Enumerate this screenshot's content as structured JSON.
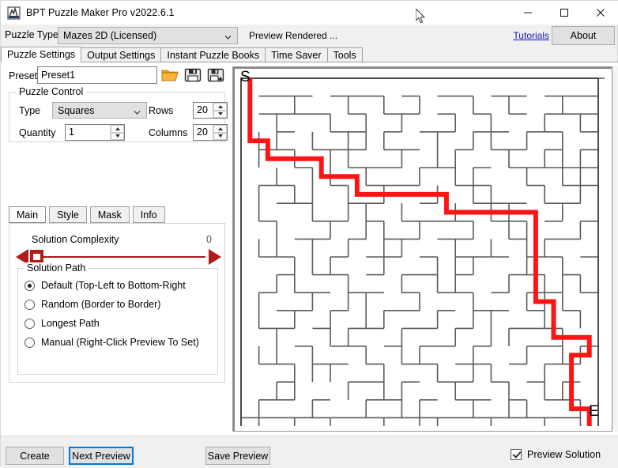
{
  "window": {
    "title": "BPT Puzzle Maker Pro v2022.6.1",
    "icon": "app-icon",
    "minimize_label": "—",
    "maximize_label": "□",
    "close_label": "✕"
  },
  "toolbar": {
    "puzzle_type_label": "Puzzle Type",
    "puzzle_type_value": "Mazes 2D (Licensed)",
    "puzzle_type_options": [
      "Mazes 2D (Licensed)"
    ],
    "preview_status": "Preview Rendered ...",
    "tutorials_label": "Tutorials",
    "about_label": "About"
  },
  "tabs": [
    {
      "label": "Puzzle Settings",
      "active": true
    },
    {
      "label": "Output Settings",
      "active": false
    },
    {
      "label": "Instant Puzzle Books",
      "active": false
    },
    {
      "label": "Time Saver",
      "active": false
    },
    {
      "label": "Tools",
      "active": false
    }
  ],
  "preset": {
    "label": "Preset",
    "value": "Preset1",
    "placeholder": "",
    "open_icon": "folder-open-icon",
    "save_icon": "floppy-save-icon",
    "save_as_icon": "floppy-save-as-icon"
  },
  "puzzle_control": {
    "title": "Puzzle Control",
    "type_label": "Type",
    "type_value": "Squares",
    "type_options": [
      "Squares"
    ],
    "quantity_label": "Quantity",
    "quantity_value": "1",
    "rows_label": "Rows",
    "rows_value": "20",
    "columns_label": "Columns",
    "columns_value": "20"
  },
  "inner_tabs": [
    {
      "label": "Main",
      "active": true
    },
    {
      "label": "Style",
      "active": false
    },
    {
      "label": "Mask",
      "active": false
    },
    {
      "label": "Info",
      "active": false
    }
  ],
  "complexity": {
    "label": "Solution Complexity",
    "value": "0",
    "min": 0,
    "max": 100,
    "position_pct": 0
  },
  "solution_path": {
    "title": "Solution Path",
    "options": [
      {
        "label": "Default (Top-Left to Bottom-Right",
        "checked": true
      },
      {
        "label": "Random (Border to Border)",
        "checked": false
      },
      {
        "label": "Longest Path",
        "checked": false
      },
      {
        "label": "Manual (Right-Click Preview To Set)",
        "checked": false
      }
    ]
  },
  "preview": {
    "start_letter": "S",
    "end_letter": "E",
    "solution_color": "#ff1414",
    "wall_color": "#5a5a5a",
    "border_color": "#4a4a4a",
    "background": "#ffffff",
    "rows": 20,
    "columns": 20
  },
  "bottom": {
    "create_label": "Create",
    "next_preview_label": "Next Preview",
    "save_preview_label": "Save Preview",
    "preview_solution_label": "Preview Solution",
    "preview_solution_checked": true
  },
  "maze": {
    "cell": 22.6,
    "ox": 6,
    "oy": 10,
    "h_walls": [
      [
        0,
        0,
        20
      ],
      [
        20,
        0,
        1
      ],
      [
        1,
        1,
        3
      ],
      [
        5,
        1,
        1
      ],
      [
        6,
        1,
        2
      ],
      [
        9,
        1,
        1
      ],
      [
        11,
        1,
        2
      ],
      [
        14,
        1,
        2
      ],
      [
        17,
        1,
        3
      ],
      [
        1,
        2,
        3
      ],
      [
        4,
        2,
        1
      ],
      [
        6,
        2,
        1
      ],
      [
        8,
        2,
        2
      ],
      [
        11,
        2,
        1
      ],
      [
        13,
        2,
        1
      ],
      [
        15,
        2,
        1
      ],
      [
        17,
        2,
        3
      ],
      [
        2,
        3,
        1
      ],
      [
        5,
        3,
        2
      ],
      [
        8,
        3,
        1
      ],
      [
        10,
        3,
        2
      ],
      [
        13,
        3,
        2
      ],
      [
        16,
        3,
        2
      ],
      [
        19,
        3,
        1
      ],
      [
        1,
        4,
        2
      ],
      [
        4,
        4,
        3
      ],
      [
        8,
        4,
        2
      ],
      [
        12,
        4,
        1
      ],
      [
        14,
        4,
        2
      ],
      [
        17,
        4,
        1
      ],
      [
        19,
        4,
        1
      ],
      [
        3,
        5,
        1
      ],
      [
        6,
        5,
        3
      ],
      [
        10,
        5,
        2
      ],
      [
        13,
        5,
        1
      ],
      [
        15,
        5,
        3
      ],
      [
        18,
        5,
        2
      ],
      [
        1,
        6,
        2
      ],
      [
        5,
        6,
        1
      ],
      [
        7,
        6,
        2
      ],
      [
        9,
        6,
        1
      ],
      [
        12,
        6,
        2
      ],
      [
        16,
        6,
        1
      ],
      [
        18,
        6,
        2
      ],
      [
        2,
        7,
        2
      ],
      [
        6,
        7,
        2
      ],
      [
        10,
        7,
        1
      ],
      [
        13,
        7,
        2
      ],
      [
        15,
        7,
        1
      ],
      [
        17,
        7,
        2
      ],
      [
        1,
        8,
        1
      ],
      [
        4,
        8,
        2
      ],
      [
        7,
        8,
        1
      ],
      [
        9,
        8,
        3
      ],
      [
        12,
        8,
        1
      ],
      [
        14,
        8,
        2
      ],
      [
        17,
        8,
        1
      ],
      [
        19,
        8,
        1
      ],
      [
        3,
        9,
        2
      ],
      [
        6,
        9,
        1
      ],
      [
        8,
        9,
        2
      ],
      [
        11,
        9,
        2
      ],
      [
        15,
        9,
        1
      ],
      [
        17,
        9,
        2
      ],
      [
        1,
        10,
        2
      ],
      [
        5,
        10,
        1
      ],
      [
        7,
        10,
        2
      ],
      [
        10,
        10,
        1
      ],
      [
        12,
        10,
        2
      ],
      [
        14,
        10,
        1
      ],
      [
        16,
        10,
        2
      ],
      [
        19,
        10,
        1
      ],
      [
        2,
        11,
        1
      ],
      [
        4,
        11,
        2
      ],
      [
        7,
        11,
        1
      ],
      [
        9,
        11,
        2
      ],
      [
        12,
        11,
        1
      ],
      [
        15,
        11,
        2
      ],
      [
        18,
        11,
        1
      ],
      [
        1,
        12,
        1
      ],
      [
        3,
        12,
        2
      ],
      [
        6,
        12,
        2
      ],
      [
        9,
        12,
        1
      ],
      [
        11,
        12,
        2
      ],
      [
        14,
        12,
        1
      ],
      [
        16,
        12,
        2
      ],
      [
        19,
        12,
        1
      ],
      [
        2,
        13,
        2
      ],
      [
        5,
        13,
        1
      ],
      [
        8,
        13,
        2
      ],
      [
        11,
        13,
        1
      ],
      [
        13,
        13,
        2
      ],
      [
        16,
        13,
        1
      ],
      [
        18,
        13,
        1
      ],
      [
        1,
        14,
        2
      ],
      [
        4,
        14,
        1
      ],
      [
        6,
        14,
        2
      ],
      [
        9,
        14,
        2
      ],
      [
        12,
        14,
        1
      ],
      [
        15,
        14,
        2
      ],
      [
        17,
        14,
        1
      ],
      [
        3,
        15,
        1
      ],
      [
        5,
        15,
        2
      ],
      [
        8,
        15,
        1
      ],
      [
        10,
        15,
        2
      ],
      [
        13,
        15,
        1
      ],
      [
        16,
        15,
        2
      ],
      [
        19,
        15,
        1
      ],
      [
        1,
        16,
        2
      ],
      [
        4,
        16,
        2
      ],
      [
        7,
        16,
        1
      ],
      [
        9,
        16,
        2
      ],
      [
        12,
        16,
        2
      ],
      [
        15,
        16,
        1
      ],
      [
        17,
        16,
        2
      ],
      [
        2,
        17,
        1
      ],
      [
        6,
        17,
        2
      ],
      [
        9,
        17,
        1
      ],
      [
        11,
        17,
        2
      ],
      [
        14,
        17,
        1
      ],
      [
        16,
        17,
        1
      ],
      [
        18,
        17,
        1
      ],
      [
        1,
        18,
        2
      ],
      [
        4,
        18,
        1
      ],
      [
        7,
        18,
        2
      ],
      [
        10,
        18,
        1
      ],
      [
        12,
        18,
        2
      ],
      [
        15,
        18,
        1
      ],
      [
        17,
        18,
        2
      ],
      [
        0,
        19,
        19
      ],
      [
        0,
        20,
        20
      ]
    ],
    "v_walls": [
      [
        0,
        0,
        20
      ],
      [
        20,
        0,
        20
      ],
      [
        3,
        1,
        1
      ],
      [
        6,
        1,
        1
      ],
      [
        8,
        1,
        1
      ],
      [
        10,
        1,
        1
      ],
      [
        13,
        1,
        1
      ],
      [
        15,
        1,
        1
      ],
      [
        18,
        1,
        1
      ],
      [
        2,
        2,
        2
      ],
      [
        5,
        2,
        1
      ],
      [
        7,
        2,
        2
      ],
      [
        9,
        2,
        1
      ],
      [
        12,
        2,
        1
      ],
      [
        14,
        2,
        2
      ],
      [
        17,
        2,
        1
      ],
      [
        19,
        2,
        1
      ],
      [
        1,
        3,
        2
      ],
      [
        4,
        3,
        1
      ],
      [
        6,
        3,
        2
      ],
      [
        8,
        3,
        1
      ],
      [
        11,
        3,
        2
      ],
      [
        13,
        3,
        1
      ],
      [
        16,
        3,
        1
      ],
      [
        18,
        3,
        2
      ],
      [
        3,
        4,
        1
      ],
      [
        5,
        4,
        2
      ],
      [
        9,
        4,
        1
      ],
      [
        12,
        4,
        2
      ],
      [
        15,
        4,
        1
      ],
      [
        17,
        4,
        1
      ],
      [
        19,
        4,
        2
      ],
      [
        2,
        5,
        1
      ],
      [
        4,
        5,
        2
      ],
      [
        7,
        5,
        1
      ],
      [
        10,
        5,
        1
      ],
      [
        13,
        5,
        2
      ],
      [
        16,
        5,
        1
      ],
      [
        18,
        5,
        1
      ],
      [
        1,
        6,
        2
      ],
      [
        3,
        6,
        1
      ],
      [
        6,
        6,
        2
      ],
      [
        8,
        6,
        1
      ],
      [
        11,
        6,
        1
      ],
      [
        14,
        6,
        2
      ],
      [
        17,
        6,
        1
      ],
      [
        19,
        6,
        1
      ],
      [
        4,
        7,
        1
      ],
      [
        7,
        7,
        2
      ],
      [
        9,
        7,
        1
      ],
      [
        12,
        7,
        1
      ],
      [
        15,
        7,
        2
      ],
      [
        18,
        7,
        1
      ],
      [
        2,
        8,
        2
      ],
      [
        5,
        8,
        1
      ],
      [
        8,
        8,
        2
      ],
      [
        10,
        8,
        1
      ],
      [
        13,
        8,
        1
      ],
      [
        16,
        8,
        2
      ],
      [
        19,
        8,
        1
      ],
      [
        1,
        9,
        1
      ],
      [
        4,
        9,
        2
      ],
      [
        6,
        9,
        1
      ],
      [
        9,
        9,
        1
      ],
      [
        12,
        9,
        2
      ],
      [
        14,
        9,
        1
      ],
      [
        17,
        9,
        1
      ],
      [
        3,
        10,
        2
      ],
      [
        5,
        10,
        1
      ],
      [
        8,
        10,
        1
      ],
      [
        11,
        10,
        2
      ],
      [
        13,
        10,
        1
      ],
      [
        16,
        10,
        1
      ],
      [
        18,
        10,
        2
      ],
      [
        2,
        11,
        1
      ],
      [
        6,
        11,
        2
      ],
      [
        9,
        11,
        1
      ],
      [
        12,
        11,
        1
      ],
      [
        15,
        11,
        1
      ],
      [
        17,
        11,
        2
      ],
      [
        19,
        11,
        1
      ],
      [
        1,
        12,
        2
      ],
      [
        4,
        12,
        1
      ],
      [
        7,
        12,
        2
      ],
      [
        10,
        12,
        1
      ],
      [
        13,
        12,
        2
      ],
      [
        16,
        12,
        1
      ],
      [
        18,
        12,
        1
      ],
      [
        3,
        13,
        1
      ],
      [
        5,
        13,
        2
      ],
      [
        8,
        13,
        1
      ],
      [
        11,
        13,
        1
      ],
      [
        14,
        13,
        2
      ],
      [
        17,
        13,
        1
      ],
      [
        19,
        13,
        1
      ],
      [
        2,
        14,
        2
      ],
      [
        6,
        14,
        1
      ],
      [
        9,
        14,
        2
      ],
      [
        12,
        14,
        1
      ],
      [
        15,
        14,
        1
      ],
      [
        18,
        14,
        2
      ],
      [
        1,
        15,
        1
      ],
      [
        4,
        15,
        2
      ],
      [
        7,
        15,
        1
      ],
      [
        10,
        15,
        1
      ],
      [
        13,
        15,
        2
      ],
      [
        16,
        15,
        1
      ],
      [
        19,
        15,
        1
      ],
      [
        3,
        16,
        2
      ],
      [
        5,
        16,
        1
      ],
      [
        8,
        16,
        2
      ],
      [
        11,
        16,
        1
      ],
      [
        14,
        16,
        1
      ],
      [
        17,
        16,
        2
      ],
      [
        2,
        17,
        1
      ],
      [
        6,
        17,
        1
      ],
      [
        9,
        17,
        2
      ],
      [
        12,
        17,
        1
      ],
      [
        15,
        17,
        2
      ],
      [
        18,
        17,
        1
      ],
      [
        1,
        18,
        2
      ],
      [
        4,
        18,
        1
      ],
      [
        7,
        18,
        1
      ],
      [
        10,
        18,
        2
      ],
      [
        13,
        18,
        1
      ],
      [
        16,
        18,
        1
      ],
      [
        19,
        18,
        2
      ],
      [
        3,
        19,
        1
      ],
      [
        5,
        19,
        1
      ],
      [
        8,
        19,
        1
      ],
      [
        11,
        19,
        1
      ],
      [
        14,
        19,
        1
      ],
      [
        17,
        19,
        1
      ]
    ],
    "solution": [
      [
        0.5,
        0
      ],
      [
        0.5,
        3.5
      ],
      [
        1.5,
        3.5
      ],
      [
        1.5,
        4.5
      ],
      [
        4.5,
        4.5
      ],
      [
        4.5,
        5.5
      ],
      [
        6.5,
        5.5
      ],
      [
        6.5,
        6.5
      ],
      [
        11.5,
        6.5
      ],
      [
        11.5,
        7.5
      ],
      [
        16.5,
        7.5
      ],
      [
        16.5,
        12.5
      ],
      [
        17.5,
        12.5
      ],
      [
        17.5,
        14.5
      ],
      [
        19.5,
        14.5
      ],
      [
        19.5,
        15.5
      ],
      [
        18.5,
        15.5
      ],
      [
        18.5,
        18.5
      ],
      [
        19.5,
        18.5
      ],
      [
        19.5,
        20
      ]
    ]
  }
}
